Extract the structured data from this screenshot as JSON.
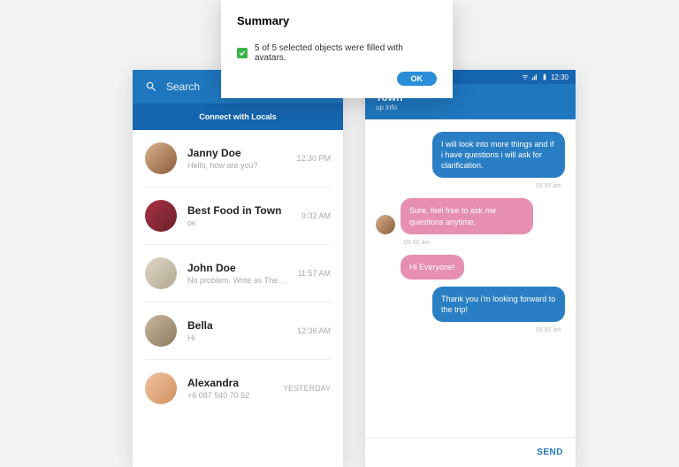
{
  "dialog": {
    "title": "Summary",
    "message": "5 of 5 selected objects were filled with avatars.",
    "ok_label": "OK"
  },
  "left": {
    "search_placeholder": "Search",
    "connect_label": "Connect with Locals",
    "chats": [
      {
        "name": "Janny Doe",
        "sub": "Hello, how are you?",
        "time": "12:30 PM"
      },
      {
        "name": "Best Food in Town",
        "sub": "ок",
        "time": "9:32 AM"
      },
      {
        "name": "John Doe",
        "sub": "No problem. Write as There will be time",
        "time": "11:57 AM"
      },
      {
        "name": "Bella",
        "sub": "Hi",
        "time": "12:36 AM"
      },
      {
        "name": "Alexandra",
        "sub": "+6 087 540 70 52",
        "time": "YESTERDAY"
      }
    ]
  },
  "right": {
    "status_time": "12:30",
    "header_title": "Town",
    "header_sub": "up info",
    "messages": [
      {
        "side": "right",
        "color": "blue",
        "text": "I will look into more things and if i have questions i will ask for clarification.",
        "time": "09.50 am"
      },
      {
        "side": "left",
        "color": "pink",
        "avatar": true,
        "text": "Sure, feel free to ask me questions anytime.",
        "time": "09.50 am"
      },
      {
        "side": "left",
        "color": "pink",
        "avatar": false,
        "text": "Hi Everyone!",
        "time": ""
      },
      {
        "side": "right",
        "color": "blue",
        "text": "Thank you i'm looking forward to the trip!",
        "time": "09.50 am"
      }
    ],
    "send_label": "SEND"
  }
}
